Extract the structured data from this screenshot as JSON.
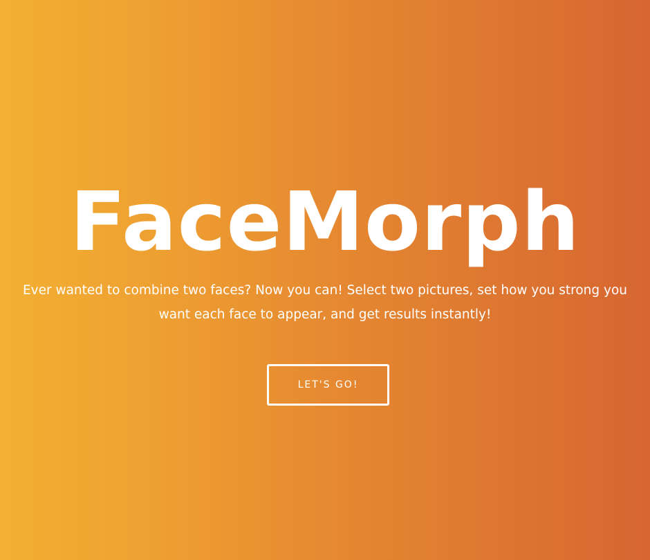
{
  "hero": {
    "title": "FaceMorph",
    "tagline_line1": "Ever wanted to combine two faces? Now you can! Select two pictures, set how you strong you",
    "tagline_line2": "want each face to appear, and get results instantly!",
    "cta_label": "LET'S GO!"
  },
  "colors": {
    "gradient_start": "#f3b033",
    "gradient_end": "#d76631",
    "text": "#ffffff"
  }
}
